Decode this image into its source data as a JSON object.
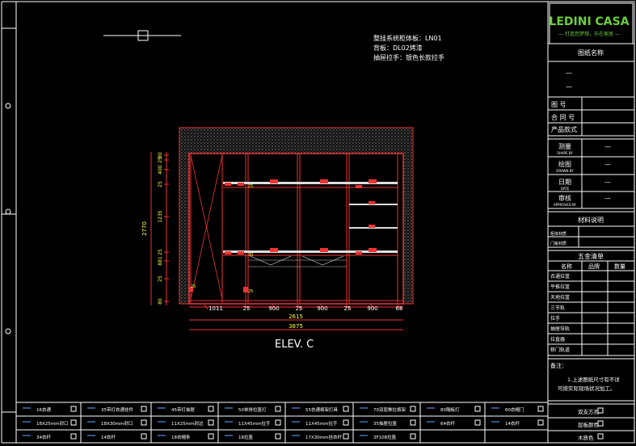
{
  "notes": {
    "line1": "整挂系统柜体板：LN01",
    "line2": "背板：DL02烤漆",
    "line3": "抽屉拉手：银色长款拉手"
  },
  "elevation_label": "ELEV. C",
  "dims": {
    "height_total": "2770",
    "left_segments": [
      "80",
      "25",
      "400",
      "25",
      "1235",
      "25",
      "881",
      "25",
      "80"
    ],
    "bottom_segments": [
      "1011",
      "25",
      "900",
      "25",
      "900",
      "25",
      "900",
      "68"
    ],
    "overall_inner": "2615",
    "overall": "3875",
    "small_vals": [
      "25",
      "25",
      "25",
      "30"
    ]
  },
  "title_block": {
    "logo": "LEDINI CASA",
    "slogan": "— 打造您梦想，乐在家居 —",
    "drawing_name": "图纸名称",
    "dash": "—",
    "drawing_no": "图    号",
    "contract_no": "合 同 号",
    "product": "产品款式",
    "measure_cn": "测量",
    "measure_en": "SHAPE BY",
    "draw_cn": "绘图",
    "draw_en": "DRAWN BY",
    "date_cn": "日期",
    "date_en": "DATE",
    "approve_cn": "审核",
    "approve_en": "APPROVED BY",
    "material_title": "材料说明",
    "material_rows": [
      "柜体材质",
      "门板材质"
    ],
    "hardware_title": "五金清单",
    "hardware_cols": [
      "名称",
      "品牌",
      "数量"
    ],
    "hardware_rows": [
      "衣通拉篮",
      "平推拉篮",
      "天地拉篮",
      "三节轨",
      "拉手",
      "抽屉导轨",
      "拉直器",
      "移门轨道"
    ],
    "note_label": "备注：",
    "note_text": "1.上述图纸尺寸有不详\n可按实际现场状况加工。",
    "footer": [
      "双支方孔",
      "层板颜色",
      "木质色"
    ]
  },
  "legend": {
    "row1": [
      "16衣通",
      "35带灯衣通挂件",
      "45带灯抽屉",
      "50单排拉篮灯",
      "55衣通裤架灯具",
      "70双层推拉裤架",
      "80隔板灯",
      "60衣帽门",
      "铰链门"
    ],
    "row2": [
      "18X25mm封口",
      "18X30mm封口",
      "11X25mm封边",
      "11X45mm拉手",
      "11X45mm拉手",
      "35抽屉拉篮",
      "64衣杆",
      "14衣杆",
      ""
    ],
    "row3": [
      "34衣杆",
      "14衣杆",
      "18衣帽条",
      "18拉篮",
      "17X30mm挂衣杆",
      "3F108拉篮",
      "",
      "",
      ""
    ]
  }
}
